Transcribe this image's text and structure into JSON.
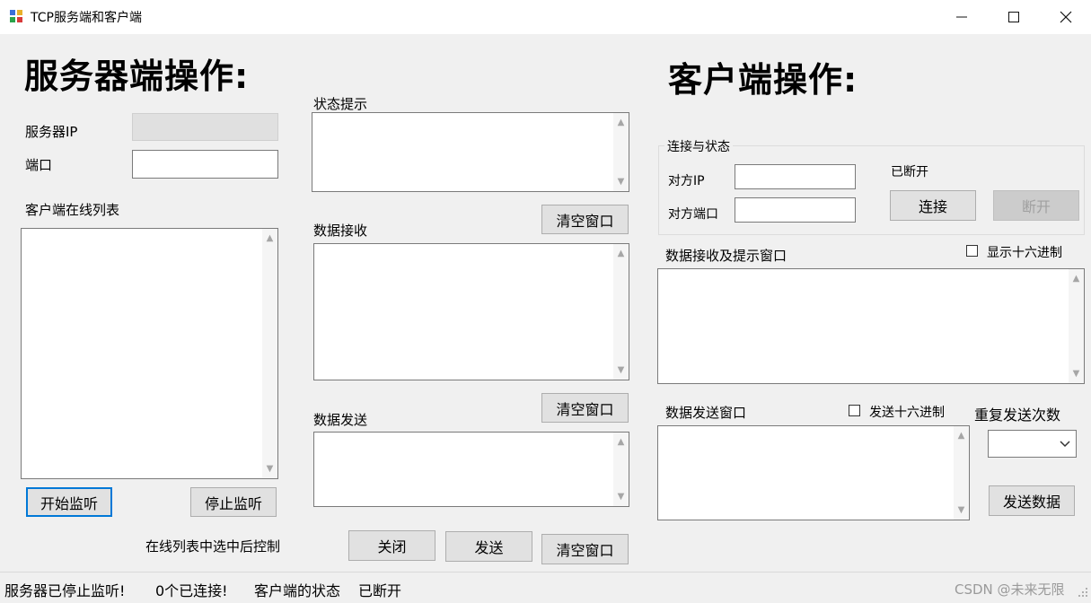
{
  "window": {
    "title": "TCP服务端和客户端",
    "minimize": "—",
    "maximize": "☐",
    "close": "✕"
  },
  "server": {
    "heading": "服务器端操作:",
    "ip_label": "服务器IP",
    "ip_value": "",
    "port_label": "端口",
    "port_value": "",
    "online_list_label": "客户端在线列表",
    "start_listen": "开始监听",
    "stop_listen": "停止监听",
    "online_control_label": "在线列表中选中后控制",
    "close_button": "关闭",
    "send_button": "发送",
    "status_label": "状态提示",
    "data_receive_label": "数据接收",
    "data_send_label": "数据发送",
    "clear_button_1": "清空窗口",
    "clear_button_2": "清空窗口",
    "clear_button_3": "清空窗口"
  },
  "client": {
    "heading": "客户端操作:",
    "group_title": "连接与状态",
    "peer_ip_label": "对方IP",
    "peer_port_label": "对方端口",
    "peer_ip_value": "",
    "peer_port_value": "",
    "connection_status": "已断开",
    "connect_button": "连接",
    "disconnect_button": "断开",
    "receive_label": "数据接收及提示窗口",
    "show_hex_label": "显示十六进制",
    "send_window_label": "数据发送窗口",
    "send_hex_label": "发送十六进制",
    "repeat_count_label": "重复发送次数",
    "repeat_count_value": "",
    "send_data_button": "发送数据"
  },
  "statusbar": {
    "server_state": "服务器已停止监听!",
    "connected_count": "0个已连接!",
    "client_state_label": "客户端的状态",
    "client_state_value": "已断开"
  },
  "watermark": "CSDN @未来无限"
}
